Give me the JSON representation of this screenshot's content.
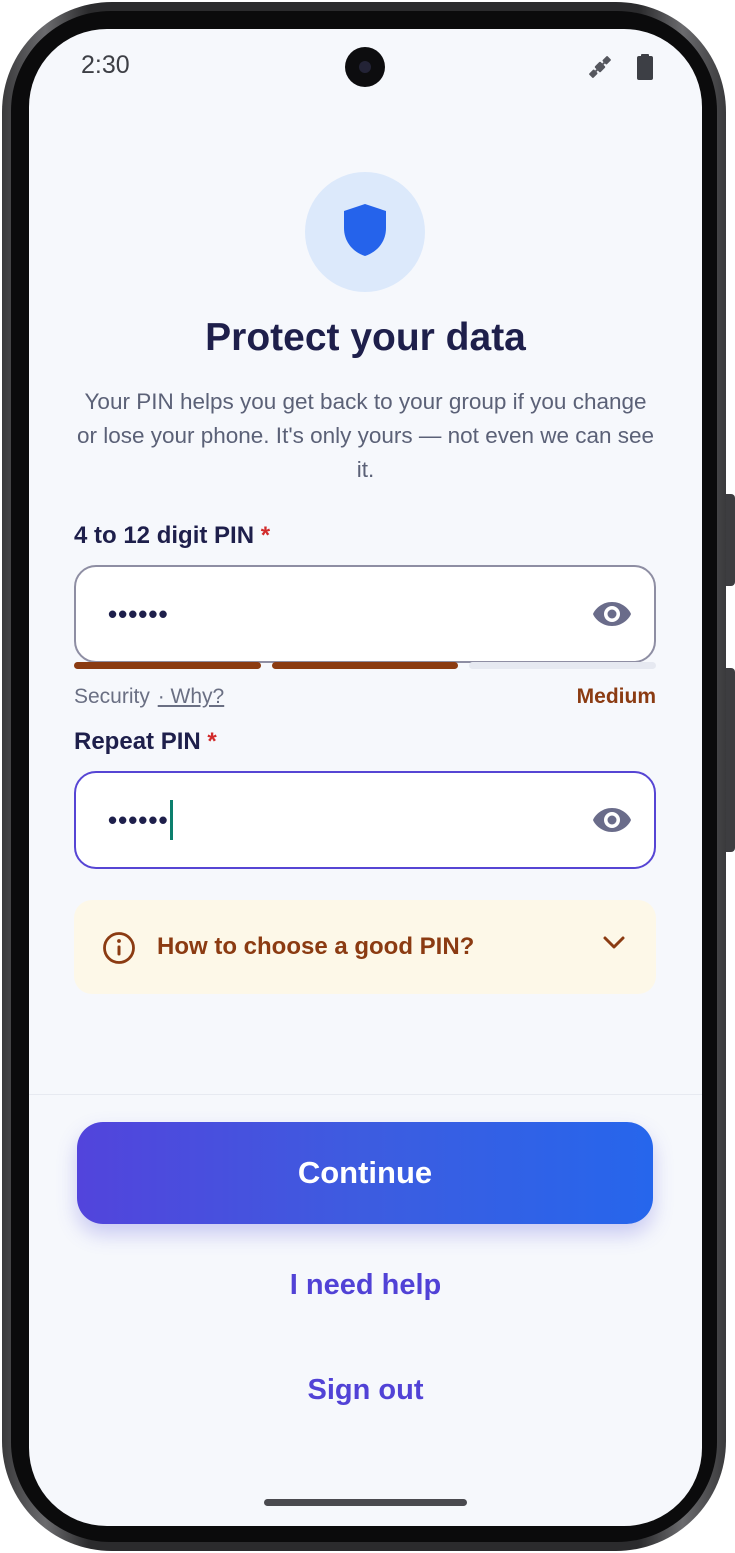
{
  "status_bar": {
    "time": "2:30",
    "icons": [
      "satellite-icon",
      "battery-icon"
    ]
  },
  "header": {
    "icon": "shield-icon",
    "title": "Protect your data",
    "subtitle": "Your PIN helps you get back to your group if you change or lose your phone. It's only yours — not even we can see it."
  },
  "pin_field": {
    "label": "4 to 12 digit PIN",
    "required_mark": "*",
    "value": "••••••",
    "toggle_icon": "eye-icon"
  },
  "strength": {
    "label": "Security",
    "why_link": "· Why?",
    "value": "Medium",
    "level": 2,
    "segments": 3
  },
  "repeat_field": {
    "label": "Repeat PIN",
    "required_mark": "*",
    "value": "••••••",
    "toggle_icon": "eye-icon"
  },
  "tip": {
    "icon": "info-icon",
    "label": "How to choose a good PIN?",
    "chevron": "chevron-down-icon"
  },
  "actions": {
    "continue": "Continue",
    "help": "I need help",
    "sign_out": "Sign out"
  },
  "colors": {
    "primary": "#5244dc",
    "primary_end": "#2666ec",
    "title": "#1e1f4b",
    "warning": "#8b3b12",
    "required": "#d22b2b",
    "tip_background": "#fdf8e8",
    "shield": "#2563eb"
  }
}
